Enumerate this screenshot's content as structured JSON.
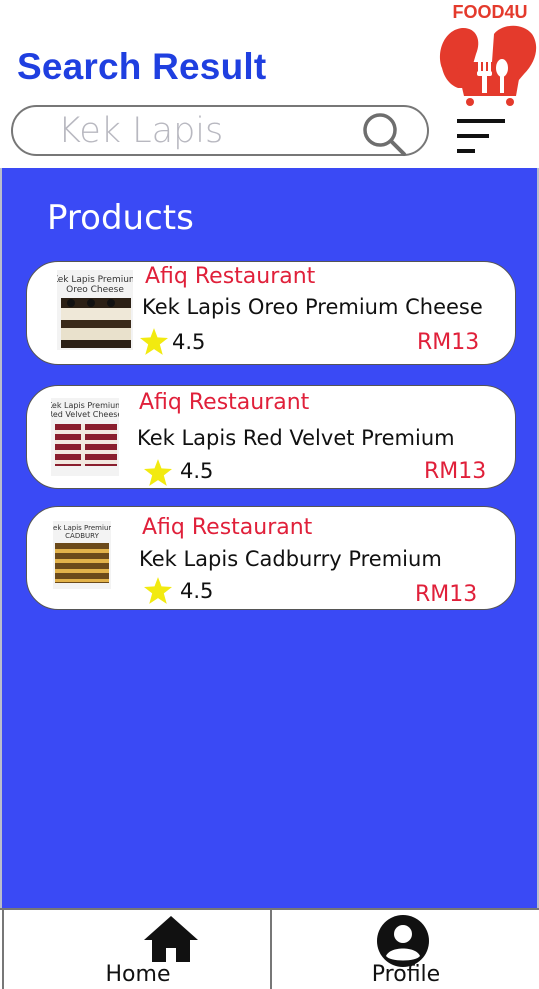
{
  "header": {
    "title": "Search Result",
    "brand": "FOOD4U"
  },
  "search": {
    "value": "Kek Lapis"
  },
  "products_section": {
    "title": "Products",
    "items": [
      {
        "restaurant": "Afiq Restaurant",
        "name": "Kek Lapis Oreo Premium Cheese",
        "rating": "4.5",
        "price": "RM13",
        "image_caption": "Kek Lapis Premium Oreo Cheese"
      },
      {
        "restaurant": "Afiq Restaurant",
        "name": "Kek Lapis Red Velvet Premium",
        "rating": "4.5",
        "price": "RM13",
        "image_caption": "Kek Lapis Premium Red Velvet Cheese"
      },
      {
        "restaurant": "Afiq Restaurant",
        "name": "Kek Lapis Cadburry Premium",
        "rating": "4.5",
        "price": "RM13",
        "image_caption": "Kek Lapis Premium CADBURY"
      }
    ]
  },
  "tabbar": {
    "home_label": "Home",
    "profile_label": "Profile"
  },
  "colors": {
    "title": "#1f3fe0",
    "panel": "#3a4af5",
    "accent": "#e0203a",
    "star": "#f2ea10",
    "brand": "#e43a2c"
  },
  "icons": [
    "search-icon",
    "filter-icon",
    "star-icon",
    "home-icon",
    "profile-icon",
    "brand-logo-icon"
  ]
}
